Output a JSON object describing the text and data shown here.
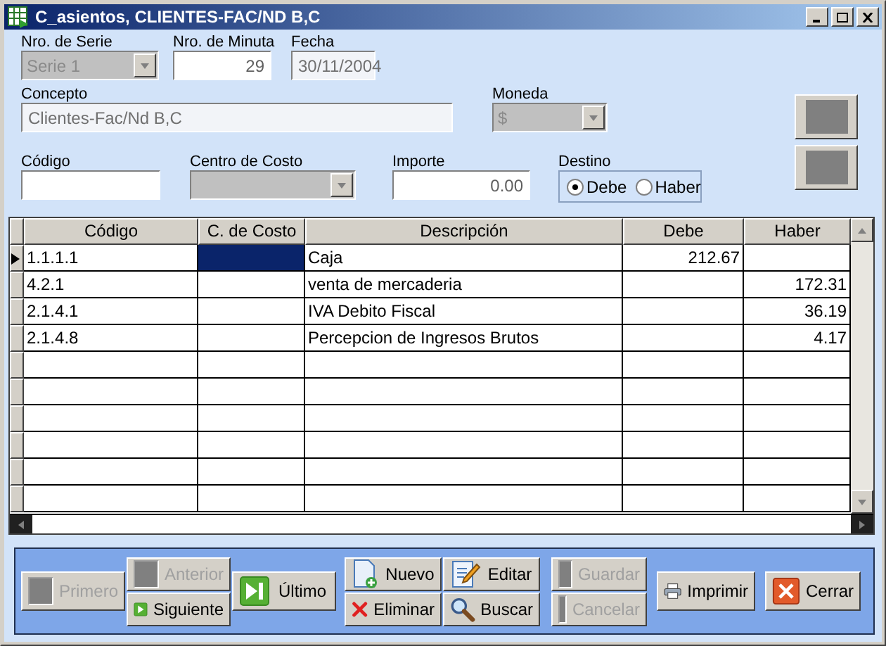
{
  "window": {
    "title": "C_asientos, CLIENTES-FAC/ND B,C"
  },
  "form": {
    "serie": {
      "label": "Nro. de Serie",
      "value": "Serie 1",
      "disabled": true
    },
    "minuta": {
      "label": "Nro. de Minuta",
      "value": "29"
    },
    "fecha": {
      "label": "Fecha",
      "value": "30/11/2004"
    },
    "concepto": {
      "label": "Concepto",
      "value": "Clientes-Fac/Nd B,C"
    },
    "moneda": {
      "label": "Moneda",
      "value": "$",
      "disabled": true
    },
    "codigo": {
      "label": "Código"
    },
    "centro": {
      "label": "Centro de Costo",
      "disabled": true
    },
    "importe": {
      "label": "Importe",
      "value": "0.00"
    },
    "destino": {
      "label": "Destino",
      "options": [
        {
          "label": "Debe",
          "selected": true
        },
        {
          "label": "Haber",
          "selected": false
        }
      ]
    }
  },
  "table": {
    "columns": [
      "Código",
      "C. de Costo",
      "Descripción",
      "Debe",
      "Haber"
    ],
    "rows": [
      {
        "selected": true,
        "cells": [
          "1.1.1.1",
          "",
          "Caja",
          "212.67",
          ""
        ]
      },
      {
        "selected": false,
        "cells": [
          "4.2.1",
          "",
          "venta de mercaderia",
          "",
          "172.31"
        ]
      },
      {
        "selected": false,
        "cells": [
          "2.1.4.1",
          "",
          "IVA Debito Fiscal",
          "",
          "36.19"
        ]
      },
      {
        "selected": false,
        "cells": [
          "2.1.4.8",
          "",
          "Percepcion de Ingresos Brutos",
          "",
          "4.17"
        ]
      }
    ]
  },
  "toolbar": [
    {
      "label": "Primero",
      "disabled": true
    },
    {
      "label": "Anterior",
      "disabled": true
    },
    {
      "label": "Siguiente",
      "disabled": false
    },
    {
      "label": "Último",
      "disabled": false
    },
    {
      "label": "Nuevo",
      "disabled": false
    },
    {
      "label": "Eliminar",
      "disabled": false
    },
    {
      "label": "Editar",
      "disabled": false
    },
    {
      "label": "Buscar",
      "disabled": false
    },
    {
      "label": "Guardar",
      "disabled": true
    },
    {
      "label": "Cancelar",
      "disabled": true
    },
    {
      "label": "Imprimir",
      "disabled": false
    },
    {
      "label": "Cerrar",
      "disabled": false
    }
  ]
}
